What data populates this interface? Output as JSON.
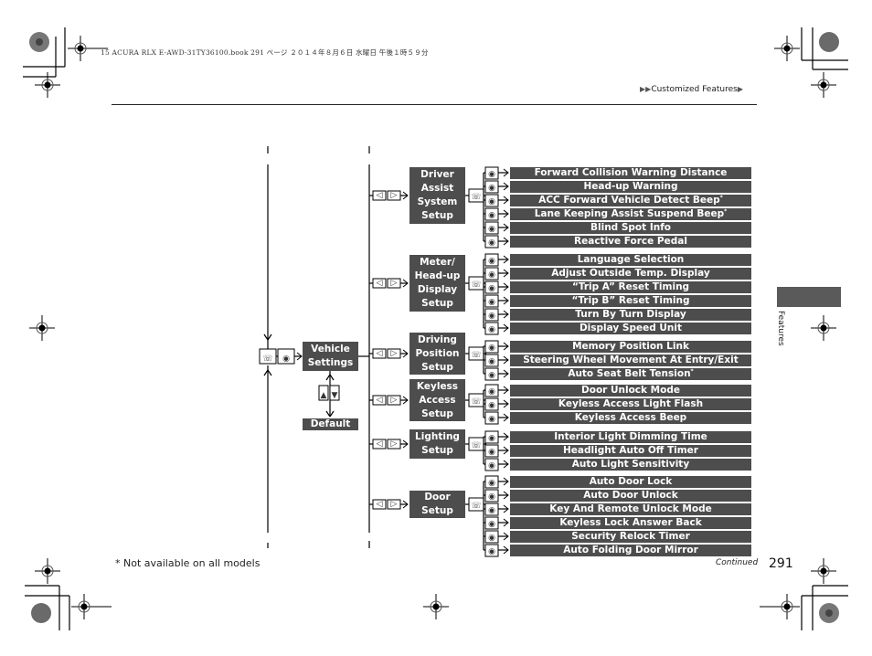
{
  "header": {
    "print_meta": "15 ACURA RLX E-AWD-31TY36100.book  291 ページ  ２０１４年８月６日  水曜日  午後１時５９分",
    "breadcrumb_prefix": "▶▶",
    "breadcrumb": "Customized Features",
    "breadcrumb_suffix": "▶"
  },
  "side_tab": {
    "label": "Features"
  },
  "diagram": {
    "root": {
      "label": "Vehicle\nSettings",
      "default_label": "Default"
    },
    "groups": [
      {
        "label": "Driver\nAssist\nSystem\nSetup",
        "items": [
          {
            "label": "Forward Collision Warning Distance",
            "note": ""
          },
          {
            "label": "Head-up Warning",
            "note": ""
          },
          {
            "label": "ACC Forward Vehicle Detect Beep",
            "note": "*"
          },
          {
            "label": "Lane Keeping Assist Suspend Beep",
            "note": "*"
          },
          {
            "label": "Blind Spot Info",
            "note": ""
          },
          {
            "label": "Reactive Force Pedal",
            "note": ""
          }
        ]
      },
      {
        "label": "Meter/\nHead-up\nDisplay\nSetup",
        "items": [
          {
            "label": "Language Selection",
            "note": ""
          },
          {
            "label": "Adjust Outside Temp. Display",
            "note": ""
          },
          {
            "label": "“Trip A” Reset Timing",
            "note": ""
          },
          {
            "label": "“Trip B” Reset Timing",
            "note": ""
          },
          {
            "label": "Turn By Turn Display",
            "note": ""
          },
          {
            "label": "Display Speed Unit",
            "note": ""
          }
        ]
      },
      {
        "label": "Driving\nPosition\nSetup",
        "items": [
          {
            "label": "Memory Position Link",
            "note": ""
          },
          {
            "label": "Steering Wheel Movement At Entry/Exit",
            "note": ""
          },
          {
            "label": "Auto Seat Belt Tension",
            "note": "*"
          }
        ]
      },
      {
        "label": "Keyless\nAccess\nSetup",
        "items": [
          {
            "label": "Door Unlock Mode",
            "note": ""
          },
          {
            "label": "Keyless Access Light Flash",
            "note": ""
          },
          {
            "label": "Keyless Access Beep",
            "note": ""
          }
        ]
      },
      {
        "label": "Lighting\nSetup",
        "items": [
          {
            "label": "Interior Light Dimming Time",
            "note": ""
          },
          {
            "label": "Headlight Auto Off Timer",
            "note": ""
          },
          {
            "label": "Auto Light Sensitivity",
            "note": ""
          }
        ]
      },
      {
        "label": "Door\nSetup",
        "items": [
          {
            "label": "Auto Door Lock",
            "note": ""
          },
          {
            "label": "Auto Door Unlock",
            "note": ""
          },
          {
            "label": "Key And Remote Unlock Mode",
            "note": ""
          },
          {
            "label": "Keyless Lock Answer Back",
            "note": ""
          },
          {
            "label": "Security Relock Timer",
            "note": ""
          },
          {
            "label": "Auto Folding Door Mirror",
            "note": ""
          }
        ]
      }
    ]
  },
  "footer": {
    "footnote": "* Not available on all models",
    "continued": "Continued",
    "page_number": "291"
  }
}
